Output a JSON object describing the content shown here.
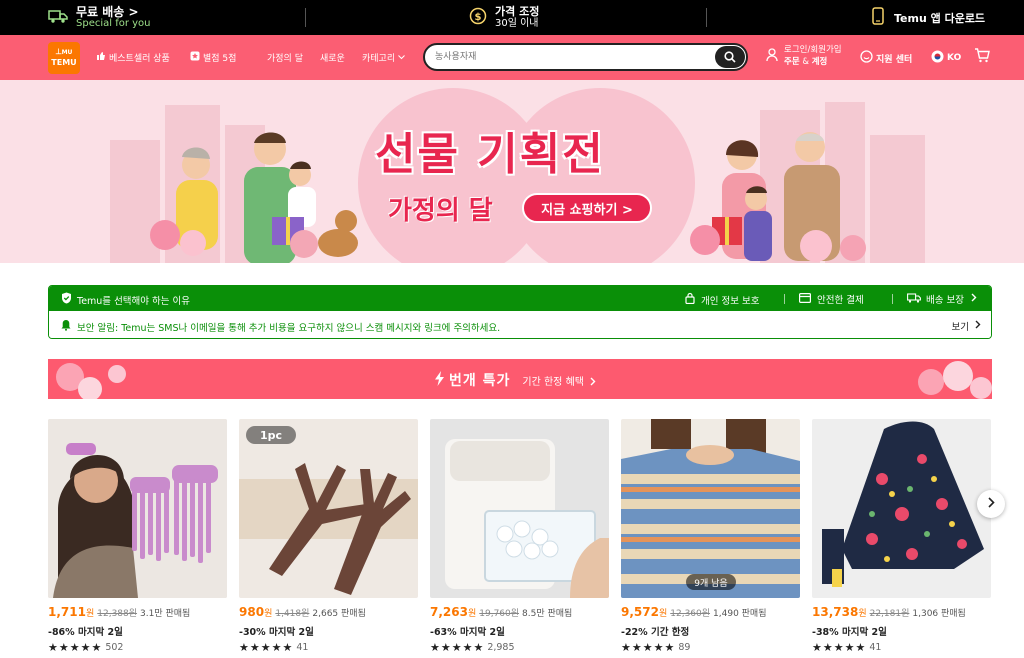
{
  "topbar": {
    "shipping_title": "무료 배송 >",
    "shipping_sub": "Special for you",
    "price_title": "가격 조정",
    "price_sub": "30일 이내",
    "app_label": "Temu 앱 다운로드"
  },
  "nav": {
    "logo_top": "丄MU",
    "logo_text": "TEMU",
    "bestseller": "베스트셀러 상품",
    "rating": "별점 5점",
    "family_month": "가정의 달",
    "new": "새로운",
    "category": "카테고리",
    "search_placeholder": "농사용자재",
    "account_line1": "로그인/회원가입",
    "account_line2_a": "주문",
    "account_line2_amp": " & ",
    "account_line2_b": "계정",
    "support": "지원 센터",
    "language": "KO"
  },
  "banner": {
    "title": "선물 기획전",
    "subtitle": "가정의 달",
    "cta": "지금 쇼핑하기 >"
  },
  "why": {
    "heading": "Temu를 선택해야 하는 이유",
    "privacy": "개인 정보 보호",
    "payment": "안전한 결제",
    "delivery": "배송 보장",
    "alert": "보안 알림: Temu는 SMS나 이메일을 통해 추가 비용을 요구하지 않으니 스캠 메시지와 링크에 주의하세요.",
    "view": "보기"
  },
  "flash": {
    "title": "번개 특가",
    "sub": "기간 한정 혜택"
  },
  "products": [
    {
      "price": "1,711",
      "unit": "원",
      "orig": "12,388원",
      "sold": "3.1만 판매됨",
      "deal": "-86% 마지막 2일",
      "stars": 4.5,
      "reviews": "502",
      "badge": ""
    },
    {
      "price": "980",
      "unit": "원",
      "orig": "1,418원",
      "sold": "2,665 판매됨",
      "deal": "-30% 마지막 2일",
      "stars": 4.5,
      "reviews": "41",
      "badge": "1pc"
    },
    {
      "price": "7,263",
      "unit": "원",
      "orig": "19,760원",
      "sold": "8.5만 판매됨",
      "deal": "-63% 마지막 2일",
      "stars": 4.5,
      "reviews": "2,985",
      "badge": ""
    },
    {
      "price": "9,572",
      "unit": "원",
      "orig": "12,360원",
      "sold": "1,490 판매됨",
      "deal": "-22% 기간 한정",
      "stars": 4.5,
      "reviews": "89",
      "badge": "9개 남음"
    },
    {
      "price": "13,738",
      "unit": "원",
      "orig": "22,181원",
      "sold": "1,306 판매됨",
      "deal": "-38% 마지막 2일",
      "stars": 4.5,
      "reviews": "41",
      "badge": ""
    }
  ],
  "colors": {
    "nav_bg": "#fb5e73",
    "accent_orange": "#fb7701",
    "trust_green": "#0a8f08",
    "banner_red": "#e8264f"
  }
}
